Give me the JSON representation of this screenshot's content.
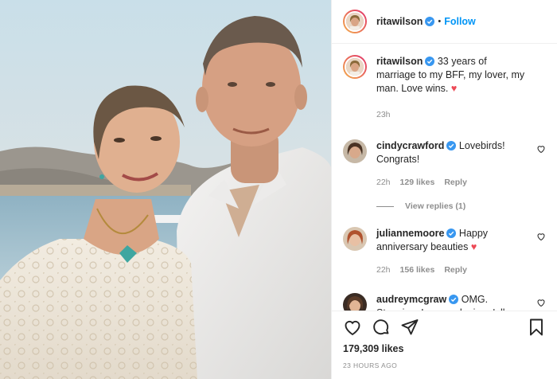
{
  "post": {
    "author": "ritawilson",
    "follow_label": "Follow",
    "dot": "•",
    "caption": "33 years of marriage to my BFF, my lover, my man. Love wins.",
    "caption_heart": "♥",
    "caption_age": "23h",
    "likes": "179,309 likes",
    "posted": "23 HOURS AGO"
  },
  "comments": [
    {
      "user": "cindycrawford",
      "text": "Lovebirds! Congrats!",
      "age": "22h",
      "likes": "129 likes",
      "reply": "Reply",
      "view_replies": "View replies (1)"
    },
    {
      "user": "julianne moore",
      "text": "Happy anniversary beauties",
      "heart": "♥",
      "age": "22h",
      "likes": "156 likes",
      "reply": "Reply"
    },
    {
      "user": "audreymcgraw",
      "text": "OMG. Stunning. Love and miss y'all so"
    }
  ],
  "colors": {
    "accent": "#0095f6",
    "verified": "#3897f0",
    "heart": "#ed4956",
    "muted": "#8e8e8e"
  },
  "icons": [
    "heart-icon",
    "comment-icon",
    "share-icon",
    "bookmark-icon",
    "verified-badge-icon"
  ]
}
